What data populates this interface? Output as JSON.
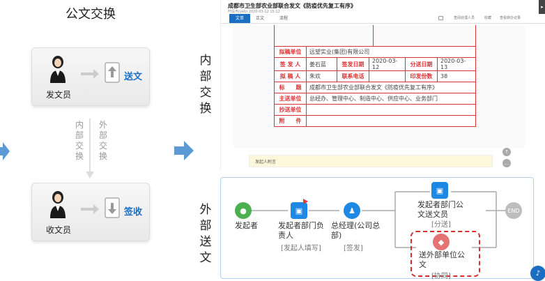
{
  "left": {
    "title": "公文交换",
    "top_card": {
      "role": "发文员",
      "action": "送文"
    },
    "middle_labels": {
      "internal": "内\n部\n交\n换",
      "external": "外\n部\n交\n换"
    },
    "bottom_card": {
      "role": "收文员",
      "action": "签收"
    }
  },
  "sections": {
    "internal": "内\n部\n交\n换",
    "external": "外\n部\n送\n文"
  },
  "doc_window": {
    "title": "成都市卫生部农业部联合发文《防疫优先复工有序》",
    "meta": "叶段杰(yeb) 2020-03-12 15:12",
    "tabs": [
      "文单",
      "正文",
      "流程"
    ],
    "toolbar": [
      "查阅处理人员",
      "收藏",
      "查看转办记录"
    ],
    "form": {
      "rows": [
        {
          "l1": "拟稿单位",
          "v1": "远望实业(集团)有限公司"
        },
        {
          "l1": "签 发 人",
          "v1": "姜石蓝",
          "l2": "签发日期",
          "v2": "2020-03-12",
          "l3": "分送日期",
          "v3": "2020-03-13"
        },
        {
          "l1": "拟 稿 人",
          "v1": "朱欢",
          "l2": "联系电话",
          "v2": "",
          "l3": "印发份数",
          "v3": "38"
        },
        {
          "l1": "标　　题",
          "v1": "成都市卫生部农业部联合发文《防疫优先复工有序》"
        },
        {
          "l1": "主送单位",
          "v1": "总经办、管理中心、制造中心、供应中心、业务部门"
        },
        {
          "l1": "抄送单位",
          "v1": ""
        },
        {
          "l1": "附　　件",
          "v1": ""
        }
      ]
    },
    "footer_note": "发起人附言"
  },
  "flow": {
    "nodes": [
      {
        "label": "发起者",
        "sub": ""
      },
      {
        "label": "发起者部门负\n责人",
        "sub": "[发起人填写]"
      },
      {
        "label": "总经理(公司总\n部)",
        "sub": "[签发]"
      },
      {
        "label": "发起者部门公\n文送文员",
        "sub": "[分送]"
      },
      {
        "label": "送外部单位公\n文",
        "sub": "[协同]"
      }
    ],
    "end_label": "END"
  },
  "colors": {
    "accent": "#1a6fc2",
    "form_red": "#d33333",
    "flow_green": "#4caf50",
    "flow_blue": "#1e88e5",
    "flow_red": "#e57373"
  }
}
